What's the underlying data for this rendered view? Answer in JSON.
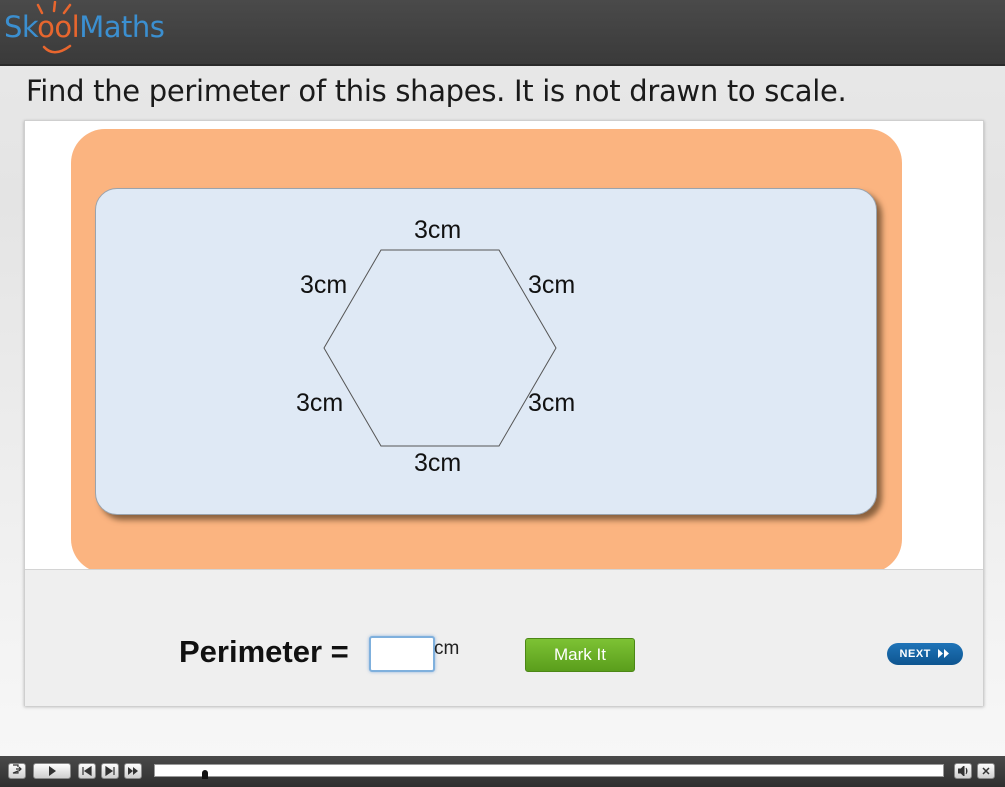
{
  "header": {
    "logo_part1": "Sk",
    "logo_part2": "ool",
    "logo_part3": "Maths"
  },
  "question": "Find the perimeter of this shapes. It is not drawn to scale.",
  "shape": {
    "type": "hexagon",
    "side_labels": [
      "3cm",
      "3cm",
      "3cm",
      "3cm",
      "3cm",
      "3cm"
    ]
  },
  "answer": {
    "label": "Perimeter =",
    "value": "",
    "unit": "cm",
    "mark_button": "Mark It",
    "next_button": "NEXT"
  },
  "player": {
    "buttons": [
      "exit-icon",
      "play-icon",
      "rewind-icon",
      "step-forward-icon",
      "fast-forward-icon",
      "volume-icon",
      "close-icon"
    ],
    "progress": 0.06
  },
  "colors": {
    "header_bg": "#3f3f3f",
    "logo_blue": "#3b8fd0",
    "logo_orange": "#e8662e",
    "frame_orange": "#fbb480",
    "shape_area": "#dfe9f5",
    "mark_green": "#6cb02a",
    "next_blue": "#1a66a8"
  }
}
